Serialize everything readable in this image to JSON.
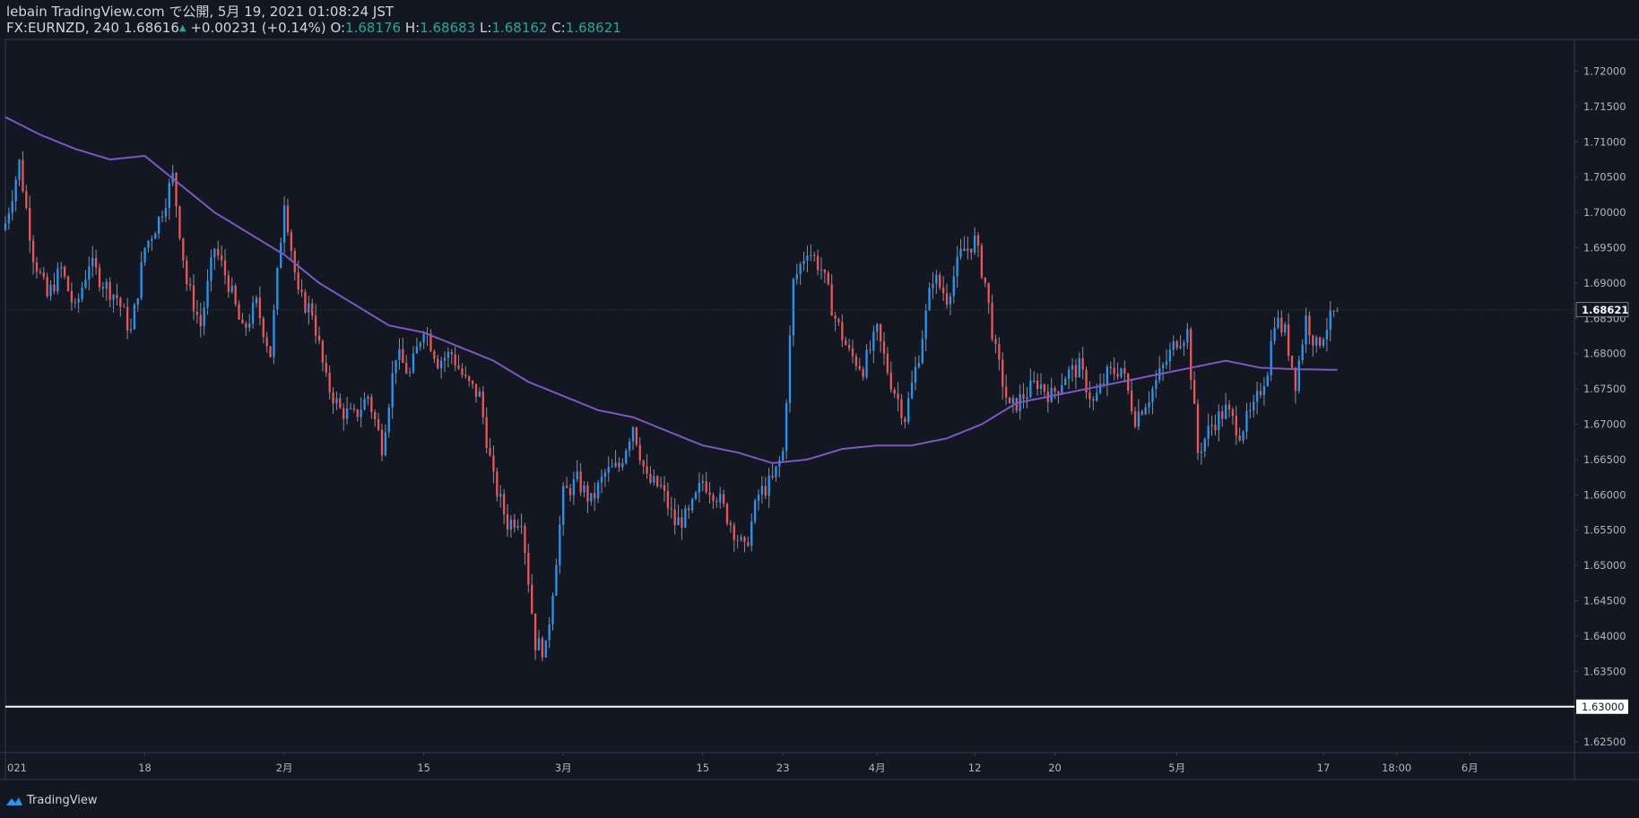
{
  "header": {
    "publish_line": "lebain TradingView.com で公開, 5月 19, 2021 01:08:24 JST",
    "symbol": "FX:EURNZD, 240",
    "last": "1.68616",
    "change": "+0.00231 (+0.14%)",
    "o_label": "O:",
    "o_value": "1.68176",
    "h_label": "H:",
    "h_value": "1.68683",
    "l_label": "L:",
    "l_value": "1.68162",
    "c_label": "C:",
    "c_value": "1.68621"
  },
  "brand": {
    "label": "TradingView",
    "icon": "tradingview-logo-icon"
  },
  "colors": {
    "background": "#131722",
    "up": "#2196f3",
    "down": "#f05350",
    "ma": "#7e57c2",
    "level_line": "#ffffff",
    "axis_text": "#b2b5be",
    "grid": "#363a45"
  },
  "chart_data": {
    "type": "candlestick",
    "symbol": "FX:EURNZD",
    "interval": "240",
    "ylim": [
      1.6235,
      1.7245
    ],
    "y_ticks": [
      1.625,
      1.63,
      1.635,
      1.64,
      1.645,
      1.65,
      1.655,
      1.66,
      1.665,
      1.67,
      1.675,
      1.68,
      1.685,
      1.69,
      1.695,
      1.7,
      1.705,
      1.71,
      1.715,
      1.72
    ],
    "y_tick_labels": [
      "1.62500",
      "1.63000",
      "1.63500",
      "1.64000",
      "1.64500",
      "1.65000",
      "1.65500",
      "1.66000",
      "1.66500",
      "1.67000",
      "1.67500",
      "1.68000",
      "1.68500",
      "1.69000",
      "1.69500",
      "1.70000",
      "1.70500",
      "1.71000",
      "1.71500",
      "1.72000"
    ],
    "x_ticks": [
      {
        "label": "021",
        "bar": 0
      },
      {
        "label": "18",
        "bar": 40
      },
      {
        "label": "2月",
        "bar": 80
      },
      {
        "label": "15",
        "bar": 120
      },
      {
        "label": "3月",
        "bar": 160
      },
      {
        "label": "15",
        "bar": 200
      },
      {
        "label": "23",
        "bar": 223
      },
      {
        "label": "4月",
        "bar": 250
      },
      {
        "label": "12",
        "bar": 278
      },
      {
        "label": "20",
        "bar": 301
      },
      {
        "label": "5月",
        "bar": 336
      },
      {
        "label": "17",
        "bar": 378
      },
      {
        "label": "18:00",
        "bar": 399
      },
      {
        "label": "6月",
        "bar": 420
      }
    ],
    "x_bar_range": [
      0,
      450
    ],
    "current_price": 1.68621,
    "current_price_label": "1.68621",
    "horizontal_level": 1.63,
    "horizontal_level_label": "1.63000",
    "close_anchors": [
      [
        0,
        1.6985
      ],
      [
        4,
        1.707
      ],
      [
        8,
        1.694
      ],
      [
        12,
        1.688
      ],
      [
        16,
        1.692
      ],
      [
        20,
        1.686
      ],
      [
        24,
        1.693
      ],
      [
        28,
        1.69
      ],
      [
        32,
        1.688
      ],
      [
        36,
        1.683
      ],
      [
        40,
        1.695
      ],
      [
        44,
        1.699
      ],
      [
        48,
        1.705
      ],
      [
        52,
        1.69
      ],
      [
        56,
        1.684
      ],
      [
        60,
        1.695
      ],
      [
        64,
        1.69
      ],
      [
        68,
        1.683
      ],
      [
        72,
        1.687
      ],
      [
        76,
        1.68
      ],
      [
        80,
        1.702
      ],
      [
        84,
        1.688
      ],
      [
        88,
        1.686
      ],
      [
        92,
        1.676
      ],
      [
        96,
        1.672
      ],
      [
        100,
        1.671
      ],
      [
        104,
        1.674
      ],
      [
        108,
        1.667
      ],
      [
        112,
        1.68
      ],
      [
        116,
        1.677
      ],
      [
        120,
        1.684
      ],
      [
        124,
        1.679
      ],
      [
        128,
        1.68
      ],
      [
        132,
        1.676
      ],
      [
        136,
        1.674
      ],
      [
        140,
        1.662
      ],
      [
        144,
        1.656
      ],
      [
        148,
        1.657
      ],
      [
        152,
        1.639
      ],
      [
        155,
        1.638
      ],
      [
        160,
        1.66
      ],
      [
        164,
        1.662
      ],
      [
        168,
        1.659
      ],
      [
        172,
        1.663
      ],
      [
        176,
        1.664
      ],
      [
        180,
        1.67
      ],
      [
        184,
        1.662
      ],
      [
        188,
        1.661
      ],
      [
        192,
        1.656
      ],
      [
        196,
        1.657
      ],
      [
        200,
        1.662
      ],
      [
        204,
        1.66
      ],
      [
        208,
        1.656
      ],
      [
        212,
        1.652
      ],
      [
        216,
        1.66
      ],
      [
        220,
        1.662
      ],
      [
        223,
        1.666
      ],
      [
        226,
        1.69
      ],
      [
        230,
        1.695
      ],
      [
        234,
        1.692
      ],
      [
        238,
        1.685
      ],
      [
        242,
        1.68
      ],
      [
        246,
        1.678
      ],
      [
        250,
        1.683
      ],
      [
        254,
        1.676
      ],
      [
        258,
        1.671
      ],
      [
        262,
        1.68
      ],
      [
        266,
        1.691
      ],
      [
        270,
        1.688
      ],
      [
        274,
        1.694
      ],
      [
        278,
        1.696
      ],
      [
        281,
        1.69
      ],
      [
        284,
        1.68
      ],
      [
        288,
        1.672
      ],
      [
        292,
        1.674
      ],
      [
        296,
        1.676
      ],
      [
        300,
        1.674
      ],
      [
        304,
        1.677
      ],
      [
        308,
        1.678
      ],
      [
        312,
        1.673
      ],
      [
        316,
        1.677
      ],
      [
        320,
        1.678
      ],
      [
        324,
        1.671
      ],
      [
        328,
        1.674
      ],
      [
        332,
        1.678
      ],
      [
        336,
        1.682
      ],
      [
        339,
        1.683
      ],
      [
        342,
        1.666
      ],
      [
        346,
        1.67
      ],
      [
        350,
        1.672
      ],
      [
        354,
        1.669
      ],
      [
        358,
        1.672
      ],
      [
        362,
        1.678
      ],
      [
        364,
        1.685
      ],
      [
        367,
        1.683
      ],
      [
        370,
        1.676
      ],
      [
        373,
        1.685
      ],
      [
        376,
        1.681
      ],
      [
        379,
        1.684
      ],
      [
        382,
        1.6862
      ]
    ],
    "ma_anchors": [
      [
        0,
        1.7135
      ],
      [
        10,
        1.711
      ],
      [
        20,
        1.709
      ],
      [
        30,
        1.7075
      ],
      [
        40,
        1.708
      ],
      [
        50,
        1.704
      ],
      [
        60,
        1.7
      ],
      [
        70,
        1.697
      ],
      [
        80,
        1.694
      ],
      [
        90,
        1.69
      ],
      [
        100,
        1.687
      ],
      [
        110,
        1.684
      ],
      [
        120,
        1.683
      ],
      [
        130,
        1.681
      ],
      [
        140,
        1.679
      ],
      [
        150,
        1.676
      ],
      [
        160,
        1.674
      ],
      [
        170,
        1.672
      ],
      [
        180,
        1.671
      ],
      [
        190,
        1.669
      ],
      [
        200,
        1.667
      ],
      [
        210,
        1.666
      ],
      [
        220,
        1.6645
      ],
      [
        230,
        1.665
      ],
      [
        240,
        1.6665
      ],
      [
        250,
        1.667
      ],
      [
        260,
        1.667
      ],
      [
        270,
        1.668
      ],
      [
        280,
        1.67
      ],
      [
        290,
        1.673
      ],
      [
        300,
        1.674
      ],
      [
        310,
        1.675
      ],
      [
        320,
        1.676
      ],
      [
        330,
        1.677
      ],
      [
        340,
        1.678
      ],
      [
        350,
        1.679
      ],
      [
        360,
        1.678
      ],
      [
        370,
        1.6778
      ],
      [
        382,
        1.6777
      ]
    ]
  }
}
